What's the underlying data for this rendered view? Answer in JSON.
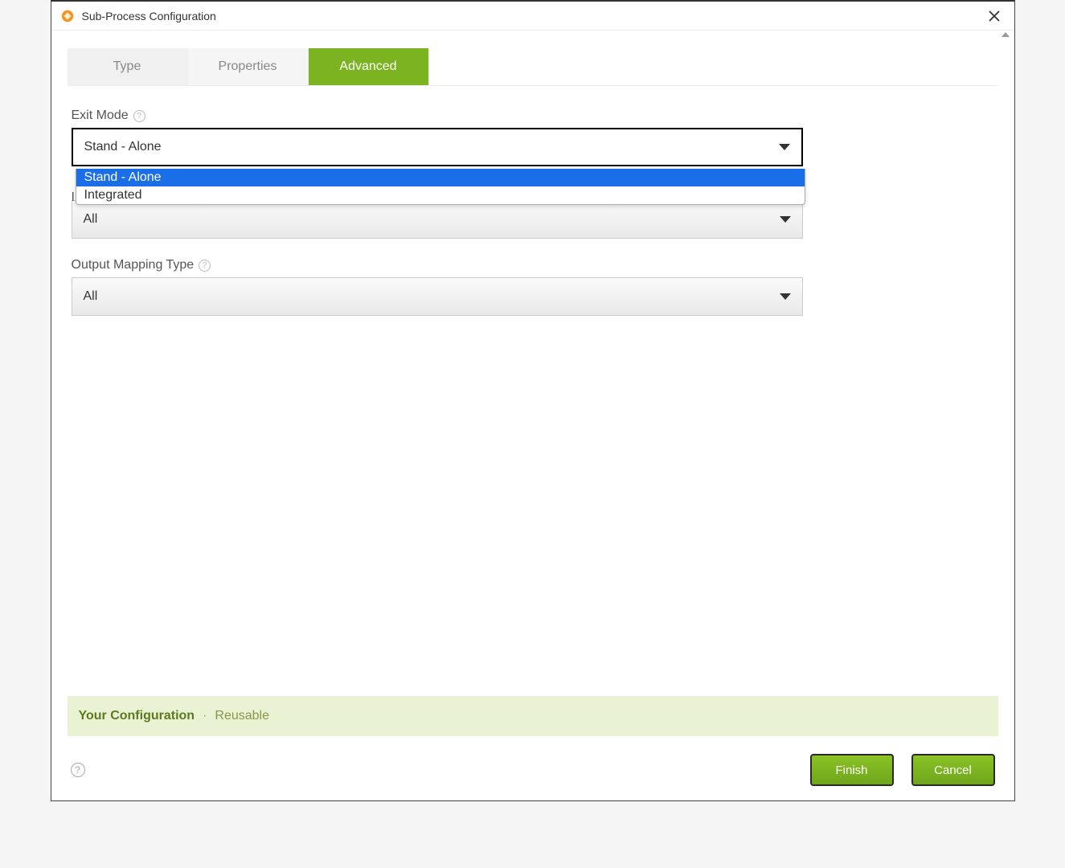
{
  "window": {
    "title": "Sub-Process Configuration"
  },
  "tabs": {
    "type": "Type",
    "properties": "Properties",
    "advanced": "Advanced",
    "active": "advanced"
  },
  "form": {
    "exit_mode": {
      "label": "Exit Mode",
      "value": "Stand - Alone",
      "options": [
        "Stand - Alone",
        "Integrated"
      ],
      "selected_index": 0
    },
    "hidden_label_prefix": "I",
    "second_select": {
      "value": "All"
    },
    "output_mapping_type": {
      "label": "Output Mapping Type",
      "value": "All"
    }
  },
  "summary": {
    "label": "Your Configuration",
    "separator": "·",
    "value": "Reusable"
  },
  "buttons": {
    "finish": "Finish",
    "cancel": "Cancel"
  },
  "colors": {
    "accent": "#7bb420",
    "highlight": "#1a6fe8"
  }
}
